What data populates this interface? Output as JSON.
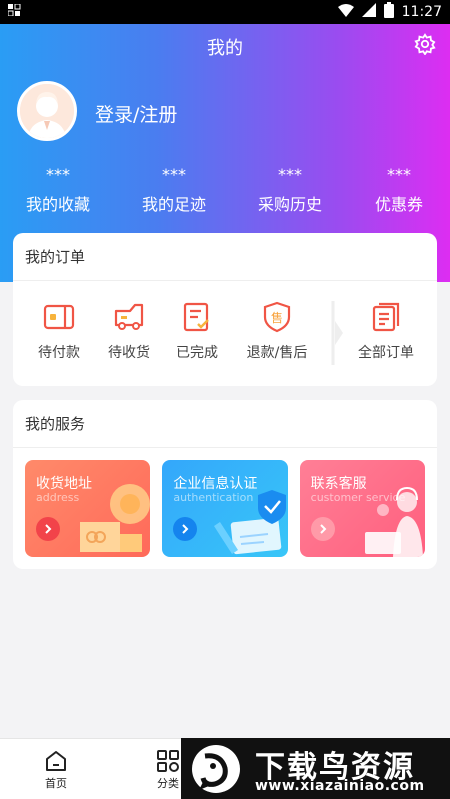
{
  "status_bar": {
    "time": "11:27",
    "battery": "B"
  },
  "header": {
    "title": "我的",
    "icon_settings": "gear-icon"
  },
  "profile": {
    "login_text": "登录/注册",
    "avatar_icon": "user-avatar"
  },
  "stats": [
    {
      "value": "***",
      "label": "我的收藏"
    },
    {
      "value": "***",
      "label": "我的足迹"
    },
    {
      "value": "***",
      "label": "采购历史"
    },
    {
      "value": "***",
      "label": "优惠券"
    }
  ],
  "orders": {
    "title": "我的订单",
    "items": [
      {
        "label": "待付款",
        "icon": "wallet-icon"
      },
      {
        "label": "待收货",
        "icon": "truck-icon"
      },
      {
        "label": "已完成",
        "icon": "checklist-icon"
      },
      {
        "label": "退款/售后",
        "icon": "after-sale-shield-icon"
      },
      {
        "label": "全部订单",
        "icon": "order-list-icon"
      }
    ],
    "after_sale_glyph": "售"
  },
  "services": {
    "title": "我的服务",
    "items": [
      {
        "title": "收货地址",
        "subtitle": "address"
      },
      {
        "title": "企业信息认证",
        "subtitle": "authentication"
      },
      {
        "title": "联系客服",
        "subtitle": "customer service"
      }
    ]
  },
  "bottom_nav": [
    {
      "label": "首页",
      "icon": "home-icon"
    },
    {
      "label": "分类",
      "icon": "category-grid-icon"
    }
  ],
  "watermark": {
    "text": "下载鸟资源",
    "url": "www.xiazainiao.com"
  },
  "colors": {
    "accent": "#f05545",
    "gradient_start": "#2a9df4",
    "gradient_end": "#dd2df2"
  }
}
